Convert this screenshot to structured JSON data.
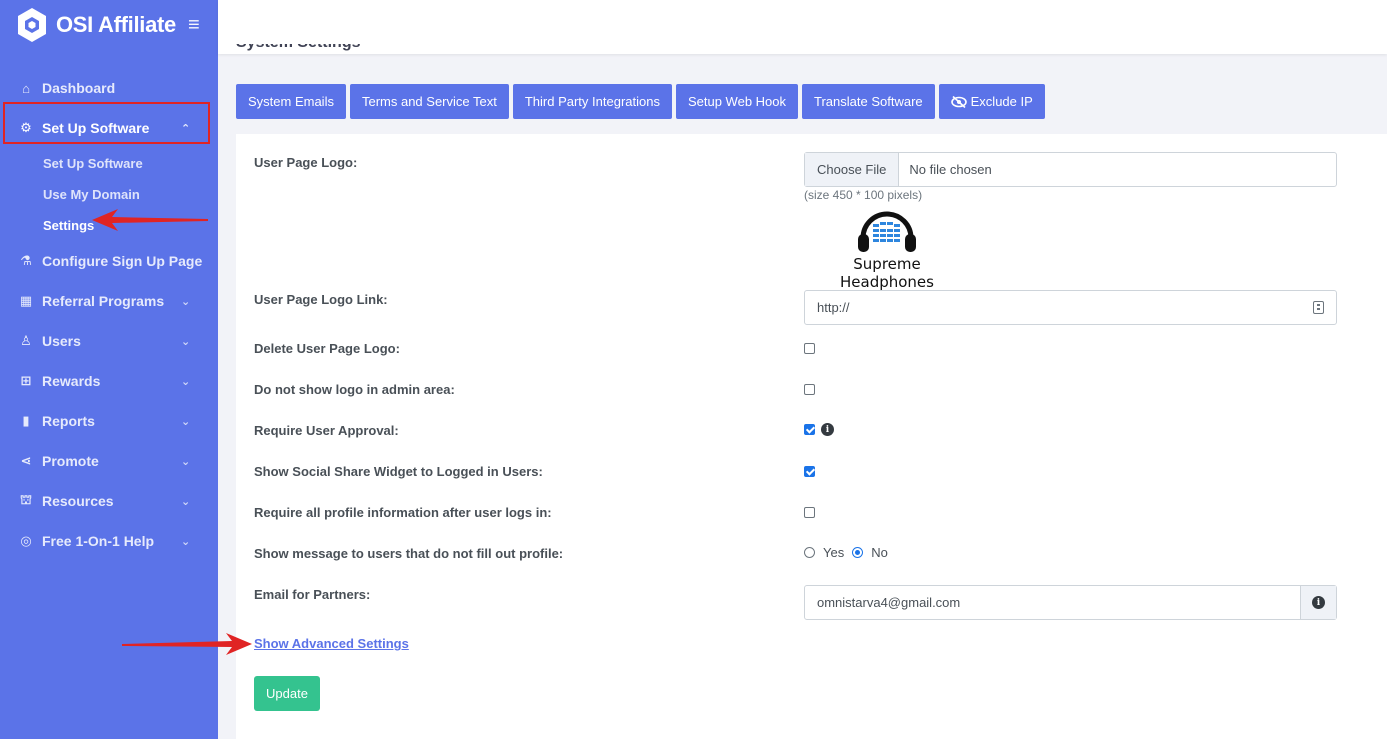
{
  "brand": {
    "title": "OSI Affiliate",
    "logo_icon": "hexagon-logo-icon",
    "menu_icon": "hamburger-icon"
  },
  "sidebar": {
    "items": [
      {
        "label": "Dashboard",
        "icon": "home-icon"
      },
      {
        "label": "Set Up Software",
        "icon": "gear-icon"
      },
      {
        "label": "Configure Sign Up Page",
        "icon": "flask-icon"
      },
      {
        "label": "Referral Programs",
        "icon": "store-icon"
      },
      {
        "label": "Users",
        "icon": "user-icon"
      },
      {
        "label": "Rewards",
        "icon": "gift-icon"
      },
      {
        "label": "Reports",
        "icon": "bar-chart-icon"
      },
      {
        "label": "Promote",
        "icon": "share-icon"
      },
      {
        "label": "Resources",
        "icon": "bank-icon"
      },
      {
        "label": "Free 1-On-1 Help",
        "icon": "lifebuoy-icon"
      }
    ],
    "subitems": [
      "Set Up Software",
      "Use My Domain",
      "Settings"
    ]
  },
  "page": {
    "title": "System Settings"
  },
  "tabs": [
    "System Emails",
    "Terms and Service Text",
    "Third Party Integrations",
    "Setup Web Hook",
    "Translate Software",
    "Exclude IP"
  ],
  "form": {
    "logo_label": "User Page Logo:",
    "file_button": "Choose File",
    "file_name": "No file chosen",
    "size_hint": "(size 450 * 100 pixels)",
    "logo_image_text": "Supreme Headphones",
    "logo_link_label": "User Page Logo Link:",
    "logo_link_value": "http://",
    "delete_logo_label": "Delete User Page Logo:",
    "delete_logo_checked": false,
    "hide_logo_label": "Do not show logo in admin area:",
    "hide_logo_checked": false,
    "require_approval_label": "Require User Approval:",
    "require_approval_checked": true,
    "social_share_label": "Show Social Share Widget to Logged in Users:",
    "social_share_checked": true,
    "require_profile_label": "Require all profile information after user logs in:",
    "require_profile_checked": false,
    "show_message_label": "Show message to users that do not fill out profile:",
    "radio_yes": "Yes",
    "radio_no": "No",
    "radio_selected": "No",
    "email_label": "Email for Partners:",
    "email_value": "omnistarva4@gmail.com",
    "advanced_link": "Show Advanced Settings",
    "update_button": "Update"
  },
  "colors": {
    "sidebar": "#5b73e8",
    "accent": "#5b73e8",
    "success": "#34c38f",
    "annotation": "#e02424",
    "checkbox": "#1a73e8"
  }
}
